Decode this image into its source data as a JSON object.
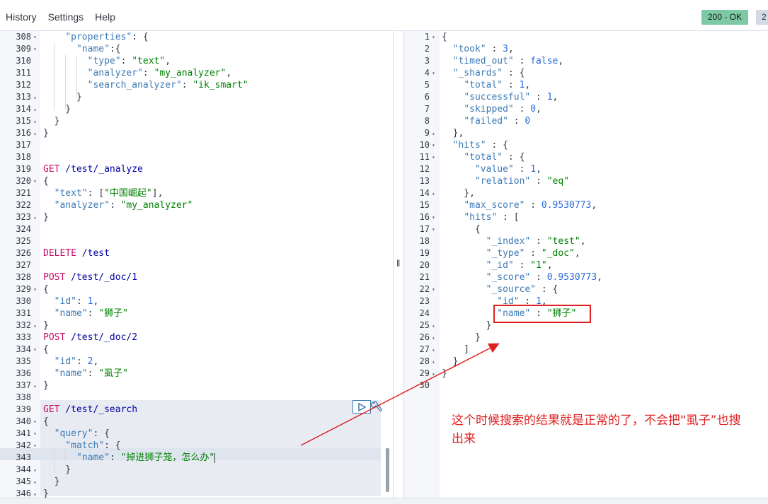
{
  "menu": {
    "history": "History",
    "settings": "Settings",
    "help": "Help"
  },
  "status": {
    "code_label": "200 - OK",
    "timing_partial": "2"
  },
  "request_lines": [
    {
      "n": "308",
      "f": "▾",
      "t": [
        [
          "    ",
          "n"
        ],
        [
          "\"properties\"",
          "k"
        ],
        [
          ": {",
          "n"
        ]
      ]
    },
    {
      "n": "309",
      "f": "▾",
      "t": [
        [
          "      ",
          "n"
        ],
        [
          "\"name\"",
          "k"
        ],
        [
          ":{",
          "n"
        ]
      ]
    },
    {
      "n": "310",
      "f": "",
      "t": [
        [
          "        ",
          "n"
        ],
        [
          "\"type\"",
          "k"
        ],
        [
          ": ",
          "n"
        ],
        [
          "\"text\"",
          "s"
        ],
        [
          ",",
          "n"
        ]
      ]
    },
    {
      "n": "311",
      "f": "",
      "t": [
        [
          "        ",
          "n"
        ],
        [
          "\"analyzer\"",
          "k"
        ],
        [
          ": ",
          "n"
        ],
        [
          "\"my_analyzer\"",
          "s"
        ],
        [
          ",",
          "n"
        ]
      ]
    },
    {
      "n": "312",
      "f": "",
      "t": [
        [
          "        ",
          "n"
        ],
        [
          "\"search_analyzer\"",
          "k"
        ],
        [
          ": ",
          "n"
        ],
        [
          "\"ik_smart\"",
          "s"
        ]
      ]
    },
    {
      "n": "313",
      "f": "▴",
      "t": [
        [
          "      }",
          "n"
        ]
      ]
    },
    {
      "n": "314",
      "f": "▴",
      "t": [
        [
          "    }",
          "n"
        ]
      ]
    },
    {
      "n": "315",
      "f": "▴",
      "t": [
        [
          "  }",
          "n"
        ]
      ]
    },
    {
      "n": "316",
      "f": "▴",
      "t": [
        [
          "}",
          "n"
        ]
      ]
    },
    {
      "n": "317",
      "f": "",
      "t": []
    },
    {
      "n": "318",
      "f": "",
      "t": []
    },
    {
      "n": "319",
      "f": "",
      "t": [
        [
          "GET",
          "m"
        ],
        [
          " /test/_analyze",
          "u"
        ]
      ]
    },
    {
      "n": "320",
      "f": "▾",
      "t": [
        [
          "{",
          "n"
        ]
      ]
    },
    {
      "n": "321",
      "f": "",
      "t": [
        [
          "  ",
          "n"
        ],
        [
          "\"text\"",
          "k"
        ],
        [
          ": [",
          "n"
        ],
        [
          "\"中国崛起\"",
          "s"
        ],
        [
          "],",
          "n"
        ]
      ]
    },
    {
      "n": "322",
      "f": "",
      "t": [
        [
          "  ",
          "n"
        ],
        [
          "\"analyzer\"",
          "k"
        ],
        [
          ": ",
          "n"
        ],
        [
          "\"my_analyzer\"",
          "s"
        ]
      ]
    },
    {
      "n": "323",
      "f": "▴",
      "t": [
        [
          "}",
          "n"
        ]
      ]
    },
    {
      "n": "324",
      "f": "",
      "t": []
    },
    {
      "n": "325",
      "f": "",
      "t": []
    },
    {
      "n": "326",
      "f": "",
      "t": [
        [
          "DELETE",
          "m"
        ],
        [
          " /test",
          "u"
        ]
      ]
    },
    {
      "n": "327",
      "f": "",
      "t": []
    },
    {
      "n": "328",
      "f": "",
      "t": [
        [
          "POST",
          "m"
        ],
        [
          " /test/_doc/1",
          "u"
        ]
      ]
    },
    {
      "n": "329",
      "f": "▾",
      "t": [
        [
          "{",
          "n"
        ]
      ]
    },
    {
      "n": "330",
      "f": "",
      "t": [
        [
          "  ",
          "n"
        ],
        [
          "\"id\"",
          "k"
        ],
        [
          ": ",
          "n"
        ],
        [
          "1",
          "b"
        ],
        [
          ",",
          "n"
        ]
      ]
    },
    {
      "n": "331",
      "f": "",
      "t": [
        [
          "  ",
          "n"
        ],
        [
          "\"name\"",
          "k"
        ],
        [
          ": ",
          "n"
        ],
        [
          "\"狮子\"",
          "s"
        ]
      ]
    },
    {
      "n": "332",
      "f": "▴",
      "t": [
        [
          "}",
          "n"
        ]
      ]
    },
    {
      "n": "333",
      "f": "",
      "t": [
        [
          "POST",
          "m"
        ],
        [
          " /test/_doc/2",
          "u"
        ]
      ]
    },
    {
      "n": "334",
      "f": "▾",
      "t": [
        [
          "{",
          "n"
        ]
      ]
    },
    {
      "n": "335",
      "f": "",
      "t": [
        [
          "  ",
          "n"
        ],
        [
          "\"id\"",
          "k"
        ],
        [
          ": ",
          "n"
        ],
        [
          "2",
          "b"
        ],
        [
          ",",
          "n"
        ]
      ]
    },
    {
      "n": "336",
      "f": "",
      "t": [
        [
          "  ",
          "n"
        ],
        [
          "\"name\"",
          "k"
        ],
        [
          ": ",
          "n"
        ],
        [
          "\"虱子\"",
          "s"
        ]
      ]
    },
    {
      "n": "337",
      "f": "▴",
      "t": [
        [
          "}",
          "n"
        ]
      ]
    },
    {
      "n": "338",
      "f": "",
      "t": []
    },
    {
      "n": "339",
      "f": "",
      "t": [
        [
          "GET",
          "m"
        ],
        [
          " /test/_search",
          "u"
        ]
      ]
    },
    {
      "n": "340",
      "f": "▾",
      "t": [
        [
          "{",
          "n"
        ]
      ]
    },
    {
      "n": "341",
      "f": "▾",
      "t": [
        [
          "  ",
          "n"
        ],
        [
          "\"query\"",
          "k"
        ],
        [
          ": {",
          "n"
        ]
      ]
    },
    {
      "n": "342",
      "f": "▾",
      "t": [
        [
          "    ",
          "n"
        ],
        [
          "\"match\"",
          "k"
        ],
        [
          ": {",
          "n"
        ]
      ]
    },
    {
      "n": "343",
      "f": "",
      "t": [
        [
          "      ",
          "n"
        ],
        [
          "\"name\"",
          "k"
        ],
        [
          ": ",
          "n"
        ],
        [
          "\"掉进狮子笼，怎么办\"",
          "s"
        ]
      ]
    },
    {
      "n": "344",
      "f": "▴",
      "t": [
        [
          "    }",
          "n"
        ]
      ]
    },
    {
      "n": "345",
      "f": "▴",
      "t": [
        [
          "  }",
          "n"
        ]
      ]
    },
    {
      "n": "346",
      "f": "▴",
      "t": [
        [
          "}",
          "n"
        ]
      ]
    }
  ],
  "response_lines": [
    {
      "n": "1",
      "f": "▾",
      "t": [
        [
          "{",
          "n"
        ]
      ]
    },
    {
      "n": "2",
      "f": "",
      "t": [
        [
          "  ",
          "n"
        ],
        [
          "\"took\"",
          "k"
        ],
        [
          " : ",
          "n"
        ],
        [
          "3",
          "b"
        ],
        [
          ",",
          "n"
        ]
      ]
    },
    {
      "n": "3",
      "f": "",
      "t": [
        [
          "  ",
          "n"
        ],
        [
          "\"timed_out\"",
          "k"
        ],
        [
          " : ",
          "n"
        ],
        [
          "false",
          "b"
        ],
        [
          ",",
          "n"
        ]
      ]
    },
    {
      "n": "4",
      "f": "▾",
      "t": [
        [
          "  ",
          "n"
        ],
        [
          "\"_shards\"",
          "k"
        ],
        [
          " : {",
          "n"
        ]
      ]
    },
    {
      "n": "5",
      "f": "",
      "t": [
        [
          "    ",
          "n"
        ],
        [
          "\"total\"",
          "k"
        ],
        [
          " : ",
          "n"
        ],
        [
          "1",
          "b"
        ],
        [
          ",",
          "n"
        ]
      ]
    },
    {
      "n": "6",
      "f": "",
      "t": [
        [
          "    ",
          "n"
        ],
        [
          "\"successful\"",
          "k"
        ],
        [
          " : ",
          "n"
        ],
        [
          "1",
          "b"
        ],
        [
          ",",
          "n"
        ]
      ]
    },
    {
      "n": "7",
      "f": "",
      "t": [
        [
          "    ",
          "n"
        ],
        [
          "\"skipped\"",
          "k"
        ],
        [
          " : ",
          "n"
        ],
        [
          "0",
          "b"
        ],
        [
          ",",
          "n"
        ]
      ]
    },
    {
      "n": "8",
      "f": "",
      "t": [
        [
          "    ",
          "n"
        ],
        [
          "\"failed\"",
          "k"
        ],
        [
          " : ",
          "n"
        ],
        [
          "0",
          "b"
        ]
      ]
    },
    {
      "n": "9",
      "f": "▴",
      "t": [
        [
          "  },",
          "n"
        ]
      ]
    },
    {
      "n": "10",
      "f": "▾",
      "t": [
        [
          "  ",
          "n"
        ],
        [
          "\"hits\"",
          "k"
        ],
        [
          " : {",
          "n"
        ]
      ]
    },
    {
      "n": "11",
      "f": "▾",
      "t": [
        [
          "    ",
          "n"
        ],
        [
          "\"total\"",
          "k"
        ],
        [
          " : {",
          "n"
        ]
      ]
    },
    {
      "n": "12",
      "f": "",
      "t": [
        [
          "      ",
          "n"
        ],
        [
          "\"value\"",
          "k"
        ],
        [
          " : ",
          "n"
        ],
        [
          "1",
          "b"
        ],
        [
          ",",
          "n"
        ]
      ]
    },
    {
      "n": "13",
      "f": "",
      "t": [
        [
          "      ",
          "n"
        ],
        [
          "\"relation\"",
          "k"
        ],
        [
          " : ",
          "n"
        ],
        [
          "\"eq\"",
          "s"
        ]
      ]
    },
    {
      "n": "14",
      "f": "▴",
      "t": [
        [
          "    },",
          "n"
        ]
      ]
    },
    {
      "n": "15",
      "f": "",
      "t": [
        [
          "    ",
          "n"
        ],
        [
          "\"max_score\"",
          "k"
        ],
        [
          " : ",
          "n"
        ],
        [
          "0.9530773",
          "b"
        ],
        [
          ",",
          "n"
        ]
      ]
    },
    {
      "n": "16",
      "f": "▾",
      "t": [
        [
          "    ",
          "n"
        ],
        [
          "\"hits\"",
          "k"
        ],
        [
          " : [",
          "n"
        ]
      ]
    },
    {
      "n": "17",
      "f": "▾",
      "t": [
        [
          "      {",
          "n"
        ]
      ]
    },
    {
      "n": "18",
      "f": "",
      "t": [
        [
          "        ",
          "n"
        ],
        [
          "\"_index\"",
          "k"
        ],
        [
          " : ",
          "n"
        ],
        [
          "\"test\"",
          "s"
        ],
        [
          ",",
          "n"
        ]
      ]
    },
    {
      "n": "19",
      "f": "",
      "t": [
        [
          "        ",
          "n"
        ],
        [
          "\"_type\"",
          "k"
        ],
        [
          " : ",
          "n"
        ],
        [
          "\"_doc\"",
          "s"
        ],
        [
          ",",
          "n"
        ]
      ]
    },
    {
      "n": "20",
      "f": "",
      "t": [
        [
          "        ",
          "n"
        ],
        [
          "\"_id\"",
          "k"
        ],
        [
          " : ",
          "n"
        ],
        [
          "\"1\"",
          "s"
        ],
        [
          ",",
          "n"
        ]
      ]
    },
    {
      "n": "21",
      "f": "",
      "t": [
        [
          "        ",
          "n"
        ],
        [
          "\"_score\"",
          "k"
        ],
        [
          " : ",
          "n"
        ],
        [
          "0.9530773",
          "b"
        ],
        [
          ",",
          "n"
        ]
      ]
    },
    {
      "n": "22",
      "f": "▾",
      "t": [
        [
          "        ",
          "n"
        ],
        [
          "\"_source\"",
          "k"
        ],
        [
          " : {",
          "n"
        ]
      ]
    },
    {
      "n": "23",
      "f": "",
      "t": [
        [
          "          ",
          "n"
        ],
        [
          "\"id\"",
          "k"
        ],
        [
          " : ",
          "n"
        ],
        [
          "1",
          "b"
        ],
        [
          ",",
          "n"
        ]
      ]
    },
    {
      "n": "24",
      "f": "",
      "t": [
        [
          "          ",
          "n"
        ],
        [
          "\"name\"",
          "k"
        ],
        [
          " : ",
          "n"
        ],
        [
          "\"狮子\"",
          "s"
        ]
      ]
    },
    {
      "n": "25",
      "f": "▴",
      "t": [
        [
          "        }",
          "n"
        ]
      ]
    },
    {
      "n": "26",
      "f": "▴",
      "t": [
        [
          "      }",
          "n"
        ]
      ]
    },
    {
      "n": "27",
      "f": "▴",
      "t": [
        [
          "    ]",
          "n"
        ]
      ]
    },
    {
      "n": "28",
      "f": "▴",
      "t": [
        [
          "  }",
          "n"
        ]
      ]
    },
    {
      "n": "29",
      "f": "▴",
      "t": [
        [
          "}",
          "n"
        ]
      ]
    },
    {
      "n": "30",
      "f": "",
      "t": []
    }
  ],
  "annotation": {
    "text": "这个时候搜索的结果就是正常的了，不会把“虱子”也搜出来"
  },
  "colors": {
    "key": "#3c7ab5",
    "string": "#008000",
    "method": "#c80a68",
    "url": "#0000a0",
    "status_ok": "#7dc9a3",
    "annotation": "#e02020"
  },
  "icons": {
    "run": "play-icon",
    "settings": "wrench-icon",
    "resize": "drag-handle-icon",
    "fold_open": "fold-open-icon",
    "fold_close": "fold-close-icon"
  }
}
